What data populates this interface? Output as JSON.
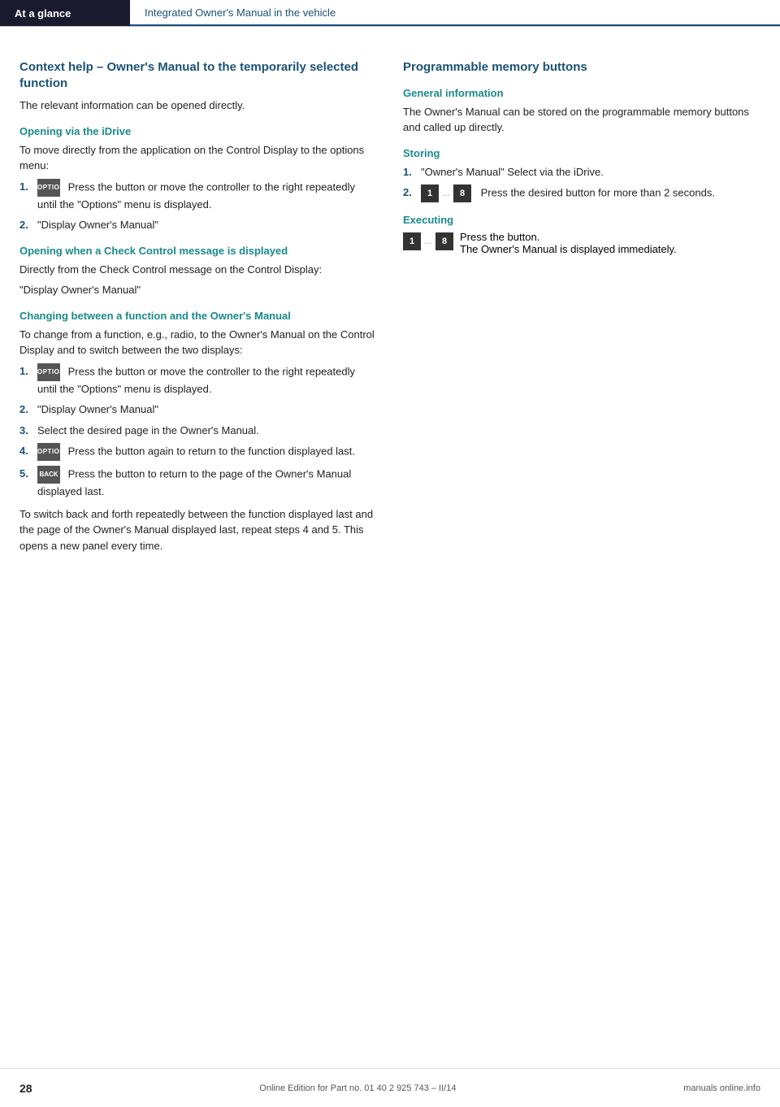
{
  "header": {
    "left_label": "At a glance",
    "right_label": "Integrated Owner's Manual in the vehicle"
  },
  "left_column": {
    "section_title": "Context help – Owner's Manual to the temporarily selected function",
    "intro_text": "The relevant information can be opened directly.",
    "subsections": [
      {
        "id": "opening-idrive",
        "title": "Opening via the iDrive",
        "body": "To move directly from the application on the Control Display to the options menu:",
        "steps": [
          {
            "num": "1.",
            "icon": "option",
            "text": "Press the button or move the controller to the right repeatedly until the \"Options\" menu is displayed."
          },
          {
            "num": "2.",
            "icon": null,
            "text": "\"Display Owner's Manual\""
          }
        ]
      },
      {
        "id": "opening-check-control",
        "title": "Opening when a Check Control message is displayed",
        "body": "Directly from the Check Control message on the Control Display:",
        "quote": "\"Display Owner's Manual\""
      },
      {
        "id": "changing-between",
        "title": "Changing between a function and the Owner's Manual",
        "body": "To change from a function, e.g., radio, to the Owner's Manual on the Control Display and to switch between the two displays:",
        "steps": [
          {
            "num": "1.",
            "icon": "option",
            "text": "Press the button or move the controller to the right repeatedly until the \"Options\" menu is displayed."
          },
          {
            "num": "2.",
            "icon": null,
            "text": "\"Display Owner's Manual\""
          },
          {
            "num": "3.",
            "icon": null,
            "text": "Select the desired page in the Owner's Manual."
          },
          {
            "num": "4.",
            "icon": "option",
            "text": "Press the button again to return to the function displayed last."
          },
          {
            "num": "5.",
            "icon": "back",
            "text": "Press the button to return to the page of the Owner's Manual displayed last."
          }
        ],
        "closing_text": "To switch back and forth repeatedly between the function displayed last and the page of the Owner's Manual displayed last, repeat steps 4 and 5. This opens a new panel every time."
      }
    ]
  },
  "right_column": {
    "section_title": "Programmable memory buttons",
    "subsections": [
      {
        "id": "general-info",
        "title": "General information",
        "body": "The Owner's Manual can be stored on the programmable memory buttons and called up directly."
      },
      {
        "id": "storing",
        "title": "Storing",
        "steps": [
          {
            "num": "1.",
            "icon": null,
            "text": "\"Owner's Manual\" Select via the iDrive."
          },
          {
            "num": "2.",
            "icon": "mem-range",
            "text": "Press the desired button for more than 2 seconds."
          }
        ]
      },
      {
        "id": "executing",
        "title": "Executing",
        "execute_line1": "Press the button.",
        "execute_line2": "The Owner's Manual is displayed immediately."
      }
    ]
  },
  "footer": {
    "page_number": "28",
    "center_text": "Online Edition for Part no. 01 40 2 925 743 – II/14",
    "right_text": "manuals online.info"
  },
  "icons": {
    "option_label": "OPTION",
    "back_label": "BACK",
    "mem1": "1",
    "mem8": "8"
  }
}
